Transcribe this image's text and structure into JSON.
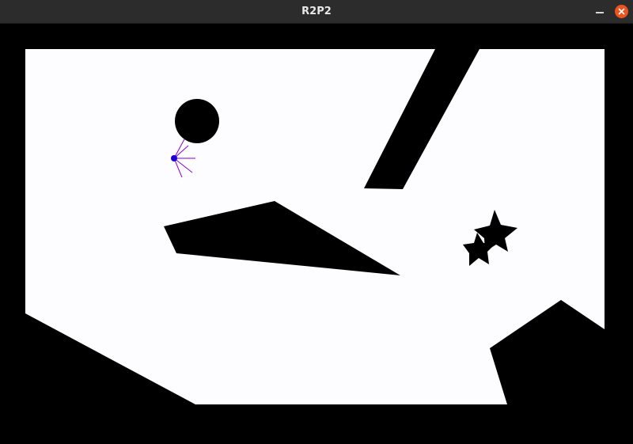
{
  "window": {
    "title": "R2P2"
  },
  "titlebar_buttons": {
    "minimize_icon": "minimize-icon",
    "close_icon": "close-icon",
    "close_color": "#e95420"
  },
  "scene": {
    "background_color": "#000000",
    "free_space_color": "#fdfcfe",
    "obstacle_color": "#000000",
    "robot": {
      "body_color": "#1a00d9",
      "sensor_ray_color": "#8a00d6",
      "sensor_ray_count": 5
    },
    "obstacles": [
      "circle",
      "slanted-bar",
      "triangle-wedge",
      "double-star",
      "bottom-left-slope",
      "bottom-right-pentagon"
    ]
  }
}
